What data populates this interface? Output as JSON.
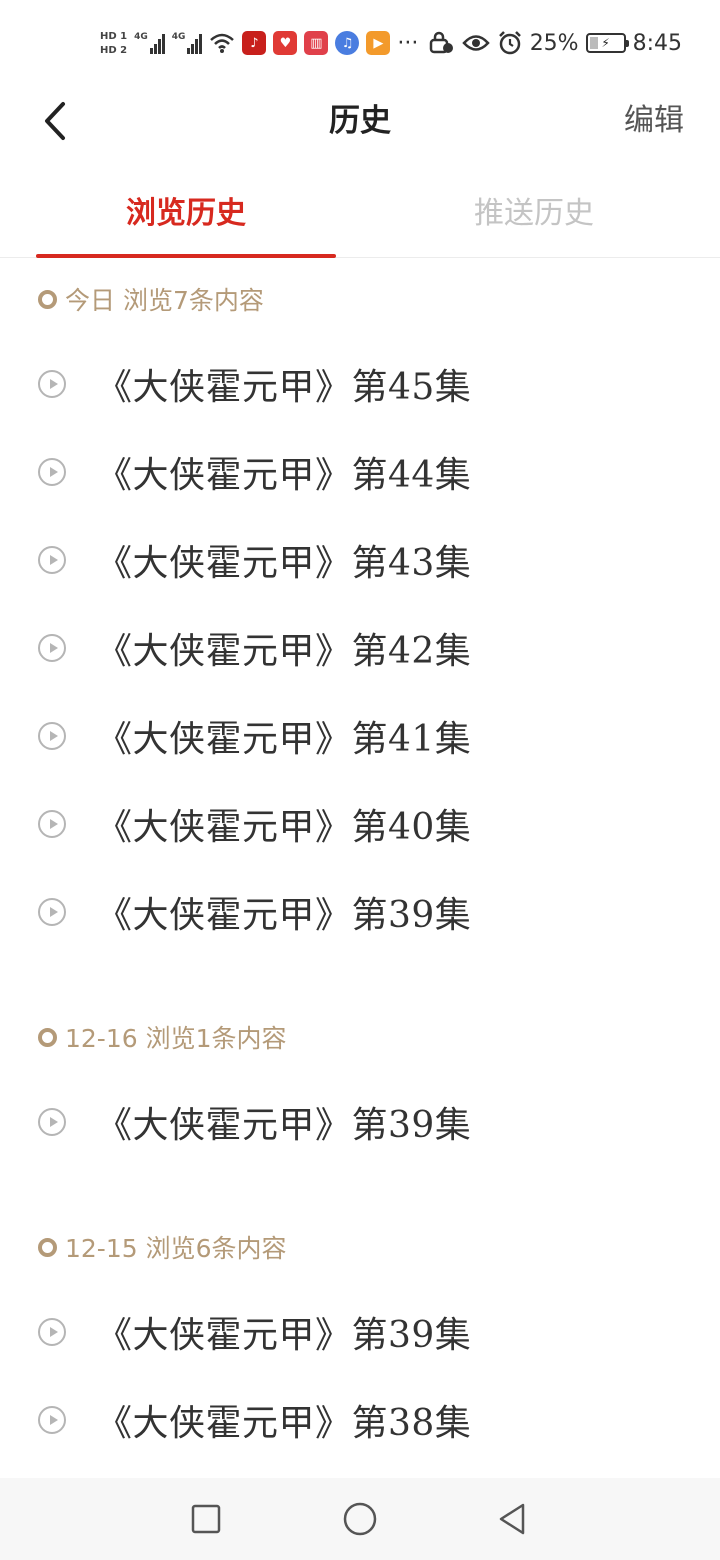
{
  "status_bar": {
    "sim1": "HD 1",
    "sim2": "HD 2",
    "net1": "4G",
    "net2": "4G",
    "dots": "···",
    "battery_percent": "25%",
    "battery_level": 0.25,
    "time": "8:45",
    "app_icons": [
      "music-app-icon",
      "heart-app-icon",
      "book-app-icon",
      "note-app-icon",
      "video-app-icon"
    ]
  },
  "header": {
    "title": "历史",
    "edit_label": "编辑"
  },
  "tabs": [
    {
      "label": "浏览历史",
      "active": true
    },
    {
      "label": "推送历史",
      "active": false
    }
  ],
  "groups": [
    {
      "header": "今日 浏览7条内容",
      "items": [
        "《大侠霍元甲》第45集",
        "《大侠霍元甲》第44集",
        "《大侠霍元甲》第43集",
        "《大侠霍元甲》第42集",
        "《大侠霍元甲》第41集",
        "《大侠霍元甲》第40集",
        "《大侠霍元甲》第39集"
      ]
    },
    {
      "header": "12-16 浏览1条内容",
      "items": [
        "《大侠霍元甲》第39集"
      ]
    },
    {
      "header": "12-15 浏览6条内容",
      "items": [
        "《大侠霍元甲》第39集",
        "《大侠霍元甲》第38集"
      ]
    }
  ],
  "colors": {
    "accent": "#d7291f",
    "group_header": "#b49a78",
    "inactive_tab": "#c4c4c4"
  }
}
